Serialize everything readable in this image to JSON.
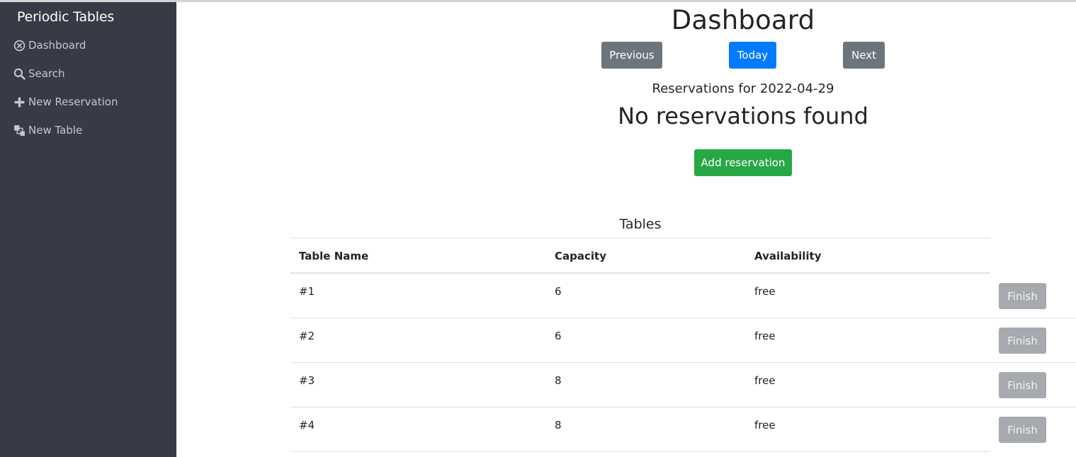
{
  "sidebar": {
    "brand": "Periodic Tables",
    "items": [
      {
        "label": "Dashboard",
        "icon": "dashboard-icon"
      },
      {
        "label": "Search",
        "icon": "search-icon"
      },
      {
        "label": "New Reservation",
        "icon": "plus-icon"
      },
      {
        "label": "New Table",
        "icon": "layers-icon"
      }
    ]
  },
  "main": {
    "title": "Dashboard",
    "nav": {
      "previous": "Previous",
      "today": "Today",
      "next": "Next"
    },
    "reservations_heading": "Reservations for 2022-04-29",
    "empty_message": "No reservations found",
    "add_button": "Add reservation"
  },
  "tables": {
    "title": "Tables",
    "columns": [
      "Table Name",
      "Capacity",
      "Availability"
    ],
    "rows": [
      {
        "name": "#1",
        "capacity": "6",
        "availability": "free",
        "action": "Finish"
      },
      {
        "name": "#2",
        "capacity": "6",
        "availability": "free",
        "action": "Finish"
      },
      {
        "name": "#3",
        "capacity": "8",
        "availability": "free",
        "action": "Finish"
      },
      {
        "name": "#4",
        "capacity": "8",
        "availability": "free",
        "action": "Finish"
      }
    ]
  },
  "colors": {
    "sidebar_bg": "#383a45",
    "primary": "#007bff",
    "secondary": "#6c757d",
    "success": "#28a745",
    "finish_disabled": "#a6a9ae"
  }
}
